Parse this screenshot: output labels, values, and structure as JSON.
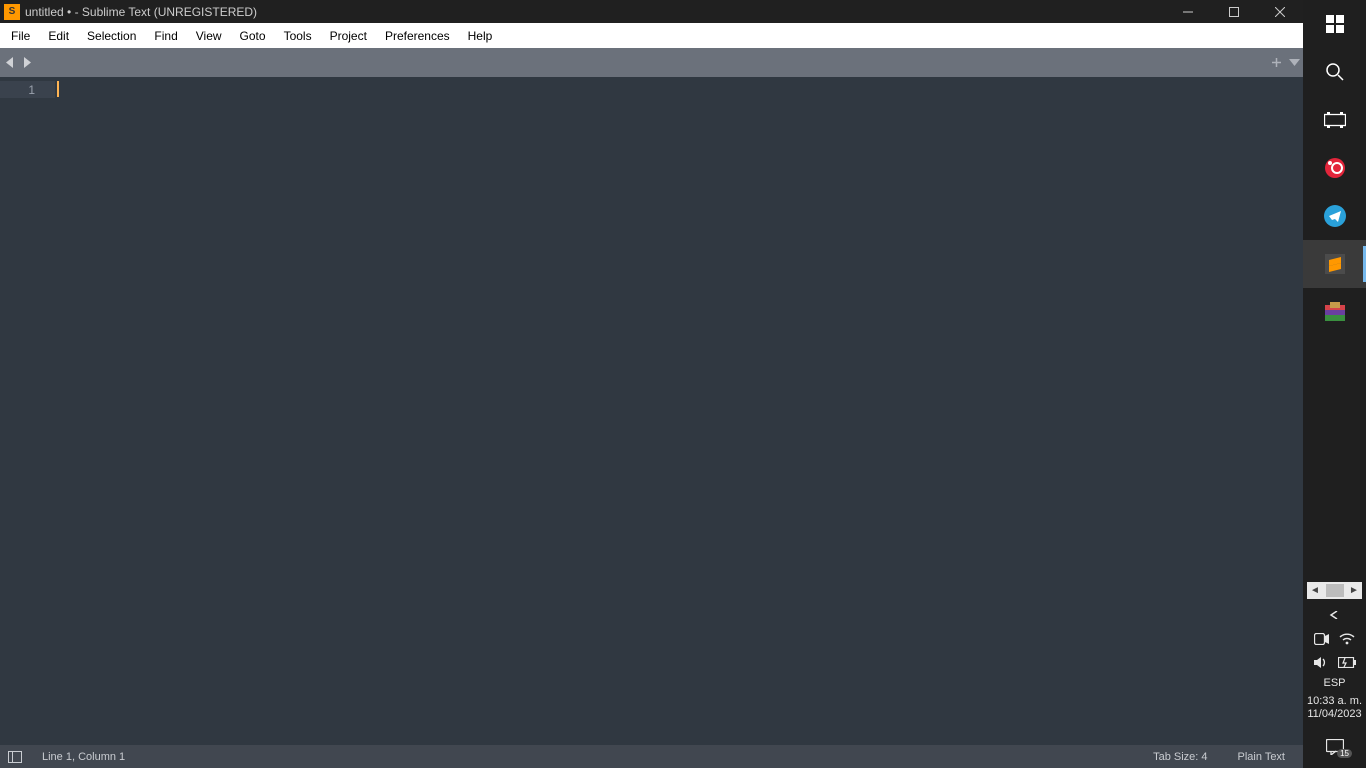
{
  "titlebar": {
    "title": "untitled • - Sublime Text (UNREGISTERED)"
  },
  "menubar": {
    "items": [
      "File",
      "Edit",
      "Selection",
      "Find",
      "View",
      "Goto",
      "Tools",
      "Project",
      "Preferences",
      "Help"
    ]
  },
  "gutter": {
    "line1": "1"
  },
  "statusbar": {
    "position": "Line 1, Column 1",
    "tabsize": "Tab Size: 4",
    "syntax": "Plain Text"
  },
  "tray": {
    "lang": "ESP",
    "time": "10:33 a. m.",
    "date": "11/04/2023",
    "notif_count": "15"
  }
}
